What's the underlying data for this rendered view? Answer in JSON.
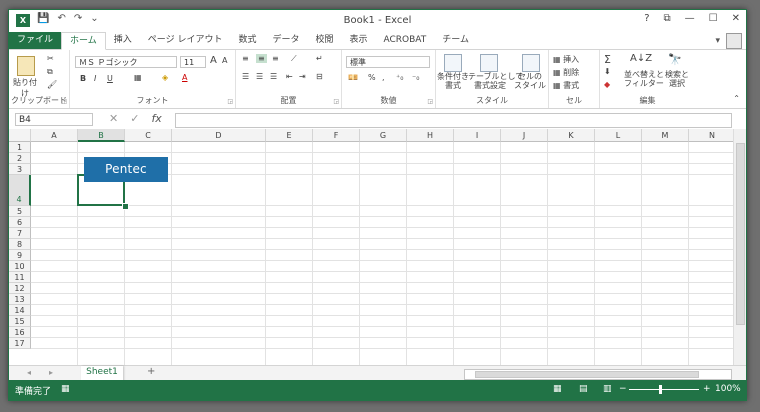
{
  "app": {
    "title": "Book1 - Excel",
    "logo_text": "X",
    "qat": {
      "save": "💾",
      "undo": "↶",
      "redo": "↷",
      "more": "⌄"
    },
    "window_controls": {
      "help": "?",
      "restore_ribbon": "⧉",
      "minimize": "—",
      "maximize": "☐",
      "close": "✕"
    }
  },
  "tabs": [
    {
      "label": "ファイル",
      "id": "file"
    },
    {
      "label": "ホーム",
      "id": "home"
    },
    {
      "label": "挿入",
      "id": "insert"
    },
    {
      "label": "ページ レイアウト",
      "id": "page-layout"
    },
    {
      "label": "数式",
      "id": "formulas"
    },
    {
      "label": "データ",
      "id": "data"
    },
    {
      "label": "校閲",
      "id": "review"
    },
    {
      "label": "表示",
      "id": "view"
    },
    {
      "label": "ACROBAT",
      "id": "acrobat"
    },
    {
      "label": "チーム",
      "id": "team"
    }
  ],
  "active_tab": "home",
  "ribbon": {
    "clipboard": {
      "paste": "貼り付け",
      "label": "クリップボード"
    },
    "font": {
      "name": "ＭＳ Ｐゴシック",
      "size": "11",
      "bold": "B",
      "italic": "I",
      "underline": "U",
      "grow": "A",
      "shrink": "A",
      "label": "フォント"
    },
    "alignment": {
      "label": "配置"
    },
    "number": {
      "format": "標準",
      "percent": "%",
      "comma": ",",
      "label": "数値"
    },
    "styles": {
      "conditional": "条件付き\n書式",
      "table": "テーブルとして\n書式設定",
      "cell": "セルの\nスタイル",
      "label": "スタイル"
    },
    "cells": {
      "insert": "挿入",
      "delete": "削除",
      "format": "書式",
      "label": "セル"
    },
    "editing": {
      "sort": "並べ替えと\nフィルター",
      "find": "検索と\n選択",
      "label": "編集"
    }
  },
  "formula_bar": {
    "name_box": "B4",
    "cancel": "✕",
    "enter": "✓",
    "fx": "fx",
    "value": ""
  },
  "columns": [
    "A",
    "B",
    "C",
    "D",
    "E",
    "F",
    "G",
    "H",
    "I",
    "J",
    "K",
    "L",
    "M",
    "N"
  ],
  "rows": [
    "1",
    "2",
    "3",
    "4",
    "5",
    "6",
    "7",
    "8",
    "9",
    "10",
    "11",
    "12",
    "13",
    "14",
    "15",
    "16",
    "17"
  ],
  "selected_cell": "B4",
  "image_logo": "Pentec",
  "sheets": [
    {
      "name": "Sheet1",
      "active": true
    }
  ],
  "add_sheet": "+",
  "status": {
    "ready": "準備完了",
    "zoom": "100%"
  },
  "colors": {
    "excel_green": "#217346",
    "logo_blue": "#1f6fa8"
  }
}
